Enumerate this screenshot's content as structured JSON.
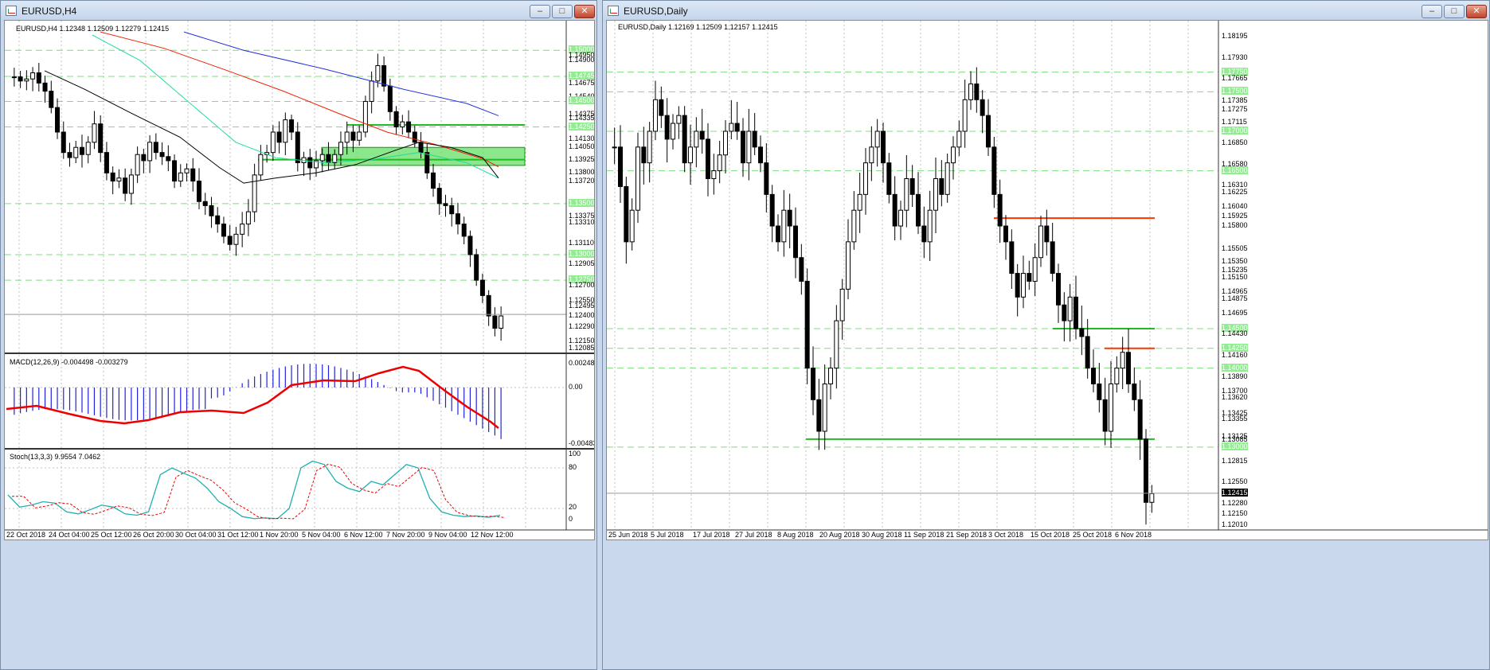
{
  "left_window": {
    "title": "EURUSD,H4",
    "header_text": "EURUSD,H4  1.12348 1.12509 1.12279 1.12415",
    "price_labels": [
      "1.15000",
      "1.14950",
      "1.14900",
      "1.14745",
      "1.14675",
      "1.14540",
      "1.14500",
      "1.14375",
      "1.14335",
      "1.14250",
      "1.14130",
      "1.14050",
      "1.13925",
      "1.13800",
      "1.13720",
      "1.13500",
      "1.13375",
      "1.13310",
      "1.13110",
      "1.13000",
      "1.12905",
      "1.12750",
      "1.12700",
      "1.12550",
      "1.12495",
      "1.12400",
      "1.12290",
      "1.12150",
      "1.12085"
    ],
    "macd_header": "MACD(12,26,9) -0.004498 -0.003279",
    "macd_labels": [
      "0.002484",
      "0.00",
      "-0.004831"
    ],
    "stoch_header": "Stoch(13,3,3) 9.9554 7.0462",
    "stoch_labels": [
      "100",
      "80",
      "20",
      "0"
    ],
    "time_labels": [
      "22 Oct 2018",
      "24 Oct 04:00",
      "25 Oct 12:00",
      "26 Oct 20:00",
      "30 Oct 04:00",
      "31 Oct 12:00",
      "1 Nov 20:00",
      "5 Nov 04:00",
      "6 Nov 12:00",
      "7 Nov 20:00",
      "9 Nov 04:00",
      "12 Nov 12:00"
    ]
  },
  "right_window": {
    "title": "EURUSD,Daily",
    "header_text": "EURUSD,Daily  1.12169 1.12509 1.12157 1.12415",
    "price_labels": [
      "1.18195",
      "1.17930",
      "1.17750",
      "1.17665",
      "1.17500",
      "1.17385",
      "1.17275",
      "1.17115",
      "1.17000",
      "1.16850",
      "1.16580",
      "1.16500",
      "1.16310",
      "1.16225",
      "1.16040",
      "1.15925",
      "1.15800",
      "1.15505",
      "1.15350",
      "1.15235",
      "1.15150",
      "1.14965",
      "1.14875",
      "1.14695",
      "1.14500",
      "1.14430",
      "1.14250",
      "1.14160",
      "1.14000",
      "1.13890",
      "1.13700",
      "1.13620",
      "1.13425",
      "1.13355",
      "1.13125",
      "1.13085",
      "1.13000",
      "1.12815",
      "1.12550",
      "1.12415",
      "1.12280",
      "1.12150",
      "1.12010"
    ],
    "current_price": "1.12415",
    "time_labels": [
      "25 Jun 2018",
      "5 Jul 2018",
      "17 Jul 2018",
      "27 Jul 2018",
      "8 Aug 2018",
      "20 Aug 2018",
      "30 Aug 2018",
      "11 Sep 2018",
      "21 Sep 2018",
      "3 Oct 2018",
      "15 Oct 2018",
      "25 Oct 2018",
      "6 Nov 2018"
    ]
  },
  "colors": {
    "label_green": "#90ee90",
    "level_green": "#22bb22",
    "level_red": "#ff3300",
    "grid": "#c0c0c0",
    "ma_blue": "#2233dd",
    "ma_red": "#ee2200",
    "ma_aqua": "#22dd99",
    "ma_black": "#000000",
    "macd_hist": "#2222dd",
    "macd_signal": "#ee0000",
    "stoch_main": "#20b0b0",
    "stoch_signal": "#ee0000"
  },
  "icons": [
    "minimize-icon",
    "maximize-icon",
    "close-icon",
    "chart-window-icon",
    "collapse-triangle-icon"
  ]
}
